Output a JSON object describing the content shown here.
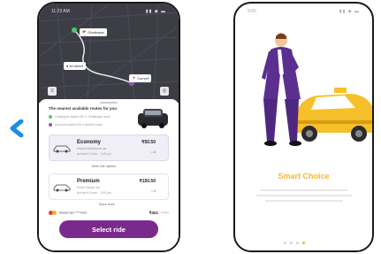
{
  "left_phone": {
    "status": {
      "time": "11:23 AM",
      "icons": "▮▮ ◆ ▬"
    },
    "map": {
      "dropoff_label": "🚩 Ghatkopar",
      "pickup_label": "📍 Current",
      "eta_label": "● Ist street"
    },
    "sheet": {
      "title": "The nearest available routes for you",
      "pickup_address": "Ghatkopar station Rd 3, Ghatkopar west",
      "drop_address": "Current location Rd 4 Andheri east",
      "rides": [
        {
          "name": "Economy",
          "sub1": "Sedan/Hatchback car",
          "sub2": "Arrival in 2 min · 1:45 pm",
          "price": "₹50.50",
          "seats": "• 4"
        },
        {
          "name": "Premium",
          "sub1": "Prime Sedan car",
          "sub2": "Arrival in 5 min · 1:50 pm",
          "price": "₹150.50",
          "seats": "• 4"
        }
      ],
      "more_options_1": "More ride options",
      "more_options_2": "Show more",
      "payment": {
        "label": "Mastercard ****4321",
        "price": "₹301",
        "extra": "2 rides"
      },
      "cta": "Select ride"
    }
  },
  "right_phone": {
    "status": {
      "time": "9:00",
      "icons": "▮▮ ◆ ▬"
    },
    "title": "Smart Choice",
    "pages": 4,
    "active_page": 4
  },
  "colors": {
    "brand_purple": "#7a2a8c",
    "accent_yellow": "#f5b73a",
    "back_arrow": "#1e8fe0",
    "map_bg": "#3c3d45"
  },
  "icons": [
    "back-chevron-icon",
    "car-sedan-icon",
    "car-premium-icon",
    "mastercard-icon",
    "pin-icon",
    "flag-icon",
    "layers-icon",
    "locate-icon"
  ]
}
